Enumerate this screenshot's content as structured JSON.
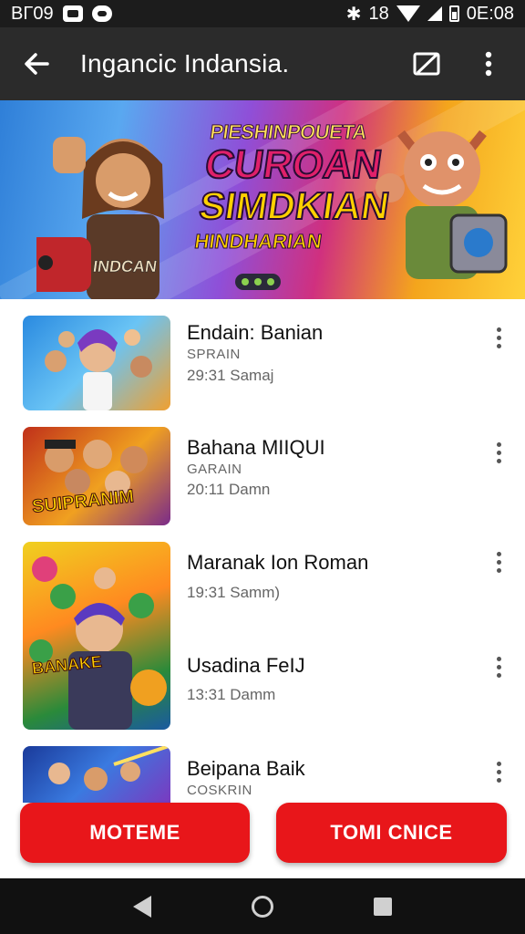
{
  "status_bar": {
    "left_text": "BΓ09",
    "time": "0E:08",
    "bt_symbol": "✱",
    "vibrate_symbol": "18"
  },
  "app_bar": {
    "title": "Ingancic Indansia."
  },
  "banner": {
    "line1": "PIESHINPOUETA",
    "line2": "CUROAN",
    "line3": "SIMDKIAN",
    "line4": "HINDHARIAN",
    "hero_caption": "INDCAN"
  },
  "items": [
    {
      "title": "Endain: Banian",
      "sub": "SPRAIN",
      "time": "29:31 Samaj",
      "thumb_word": ""
    },
    {
      "title": "Bahana MIIQUI",
      "sub": "GARAIN",
      "time": "20:11 Damn",
      "thumb_word": "SUIPRANIM"
    },
    {
      "title": "Maranak Ion Roman",
      "sub": "",
      "time": "19:31 Samm)",
      "thumb_word": ""
    },
    {
      "title": "Usadina FeIJ",
      "sub": "",
      "time": "13:31 Damm",
      "thumb_word": "BANAKE"
    },
    {
      "title": "Beipana Baik",
      "sub": "COSKRIN",
      "time": "",
      "thumb_word": ""
    }
  ],
  "buttons": {
    "left_label": "MOTEME",
    "right_label": "TOMI CNICE"
  },
  "colors": {
    "accent_red": "#e8161a",
    "app_bar": "#2b2b2b",
    "status_bar": "#1c1c1c"
  }
}
